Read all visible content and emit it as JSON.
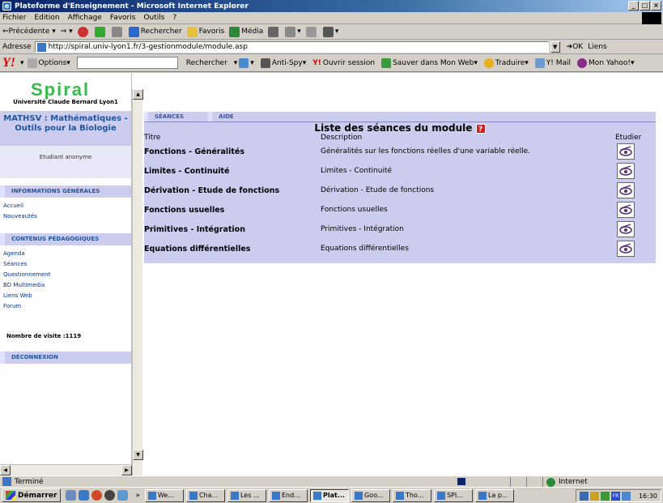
{
  "window": {
    "title": "Plateforme d'Enseignement - Microsoft Internet Explorer"
  },
  "menu": [
    "Fichier",
    "Edition",
    "Affichage",
    "Favoris",
    "Outils",
    "?"
  ],
  "toolbar": {
    "back": "Précédente",
    "search": "Rechercher",
    "favorites": "Favoris",
    "media": "Média"
  },
  "address": {
    "label": "Adresse",
    "url": "http://spiral.univ-lyon1.fr/3-gestionmodule/module.asp",
    "go": "OK",
    "links": "Liens"
  },
  "yahoo": {
    "logo": "Y!",
    "options": "Options",
    "search": "Rechercher",
    "antispy": "Anti-Spy",
    "open_session": "Ouvrir session",
    "save_web": "Sauver dans Mon Web",
    "translate": "Traduire",
    "mail": "Y! Mail",
    "my_yahoo": "Mon Yahoo!"
  },
  "sidebar": {
    "logo": "Spiral",
    "university": "Université Claude Bernard Lyon1",
    "module_title": "MATHSV : Mathématiques - Outils pour la Biologie",
    "student": "Etudiant anonyme",
    "section_info": "INFORMATIONS GÉNÉRALES",
    "info_links": [
      "Accueil",
      "Nouveautés"
    ],
    "section_content": "CONTENUS PÉDAGOGIQUES",
    "content_links": [
      "Agenda",
      "Séances",
      "Questionnement",
      "BD Multimedia",
      "Liens Web",
      "Forum"
    ],
    "visits": "Nombre de visite :1119",
    "logout": "DÉCONNEXION"
  },
  "main": {
    "tabs": [
      "SÉANCES",
      "AIDE"
    ],
    "list_title": "Liste des séances du module",
    "help": "?",
    "columns": [
      "Titre",
      "Description",
      "Etudier"
    ],
    "rows": [
      {
        "title": "Fonctions - Généralités",
        "description": "Généralités sur les fonctions réelles d'une variable réelle."
      },
      {
        "title": "Limites - Continuité",
        "description": "Limites - Continuité"
      },
      {
        "title": "Dérivation - Etude de fonctions",
        "description": "Dérivation - Etude de fonctions"
      },
      {
        "title": "Fonctions usuelles",
        "description": "Fonctions usuelles"
      },
      {
        "title": "Primitives - Intégration",
        "description": "Primitives - Intégration"
      },
      {
        "title": "Equations différentielles",
        "description": "Equations différentielles"
      }
    ]
  },
  "status": {
    "text": "Terminé",
    "zone": "Internet"
  },
  "taskbar": {
    "start": "Démarrer",
    "tasks": [
      "We...",
      "Cha...",
      "Les ...",
      "End...",
      "Plat...",
      "Goo...",
      "Tho...",
      "SPI...",
      "La p..."
    ],
    "clock": "16:30"
  }
}
